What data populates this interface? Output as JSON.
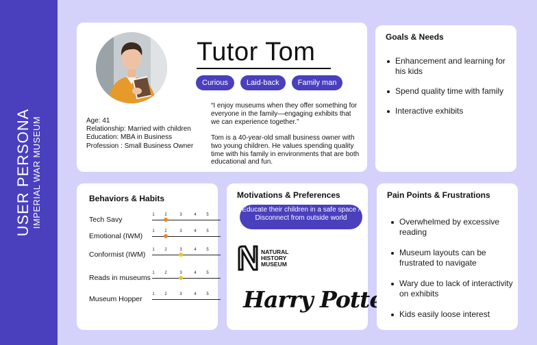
{
  "sidebar": {
    "title": "USER PERSONA",
    "subtitle": "IMPERIAL WAR MUSEUM"
  },
  "profile": {
    "name": "Tutor Tom",
    "tags": [
      "Curious",
      "Laid-back",
      "Family man"
    ],
    "facts": [
      "Age: 41",
      "Relationship: Married with children",
      "Education: MBA in Business",
      "Profession : Small Business Owner"
    ],
    "quote": "“I enjoy museums when they offer something for everyone in the family—engaging exhibits that we can experience together.”",
    "bio": "Tom is a 40-year-old small business owner with two young children. He values spending quality time with his family in environments that are both educational and fun."
  },
  "goals": {
    "title": "Goals & Needs",
    "items": [
      "Enhancement and learning for his kids",
      "Spend quality time with family",
      "Interactive exhibits"
    ]
  },
  "behaviors": {
    "title": "Behaviors & Habits",
    "scale_labels": [
      "1",
      "2",
      "3",
      "4",
      "5"
    ],
    "dot_colors": {
      "orange": "#e8862a",
      "yellow": "#e8c81f"
    },
    "items": [
      {
        "label": "Tech Savy",
        "value": 2,
        "color": "orange"
      },
      {
        "label": "Emotional (IWM)",
        "value": 2,
        "color": "orange"
      },
      {
        "label": "Conformist (IWM)",
        "value": 3,
        "color": "yellow"
      },
      {
        "label": "Reads in museums",
        "value": 3,
        "color": "yellow"
      },
      {
        "label": "Museum Hopper",
        "value": null,
        "color": ""
      }
    ]
  },
  "motivations": {
    "title": "Motivations & Preferences",
    "pill_text": "Educate their children in a safe space / Disconnect from outside world",
    "nhm_logo_text": [
      "NATURAL",
      "HISTORY",
      "MUSEUM"
    ],
    "hp_logo_text": "Harry Potter"
  },
  "pain": {
    "title": "Pain Points  & Frustrations",
    "items": [
      "Overwhelmed by excessive reading",
      "Museum layouts can be frustrated to navigate",
      "Wary due to lack of interactivity on exhibits",
      "Kids easily loose interest"
    ]
  },
  "colors": {
    "accent": "#4a3fbd",
    "background": "#d4d2fb",
    "card": "#ffffff"
  }
}
